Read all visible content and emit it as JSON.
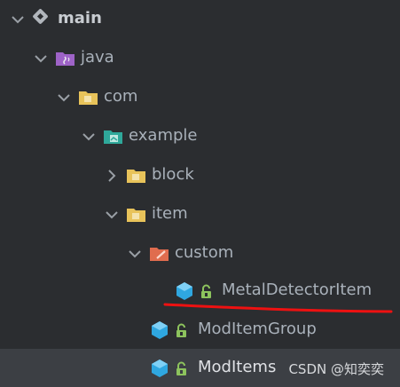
{
  "tree": {
    "main": {
      "label": "main",
      "icon": "module-folder-icon"
    },
    "java": {
      "label": "java",
      "icon": "source-root-folder-icon"
    },
    "com": {
      "label": "com",
      "icon": "package-folder-icon"
    },
    "example": {
      "label": "example",
      "icon": "package-folder-icon"
    },
    "block": {
      "label": "block",
      "icon": "package-folder-icon"
    },
    "item": {
      "label": "item",
      "icon": "package-folder-icon"
    },
    "custom": {
      "label": "custom",
      "icon": "package-folder-icon"
    },
    "metal_detector_item": {
      "label": "MetalDetectorItem",
      "icon": "class-icon"
    },
    "mod_item_group": {
      "label": "ModItemGroup",
      "icon": "class-icon"
    },
    "mod_items": {
      "label": "ModItems",
      "icon": "class-icon",
      "selected": true
    }
  },
  "watermark": "CSDN @知奕奕",
  "colors": {
    "background": "#2b2d30",
    "selected_row": "#3c3f44",
    "text": "#a9b1ba",
    "folder": "#e8c35a",
    "class_icon": "#2fa7e0",
    "lock": "#8dc35d",
    "source_root": "#9e63c7",
    "annotation_underline": "#ee1111"
  }
}
